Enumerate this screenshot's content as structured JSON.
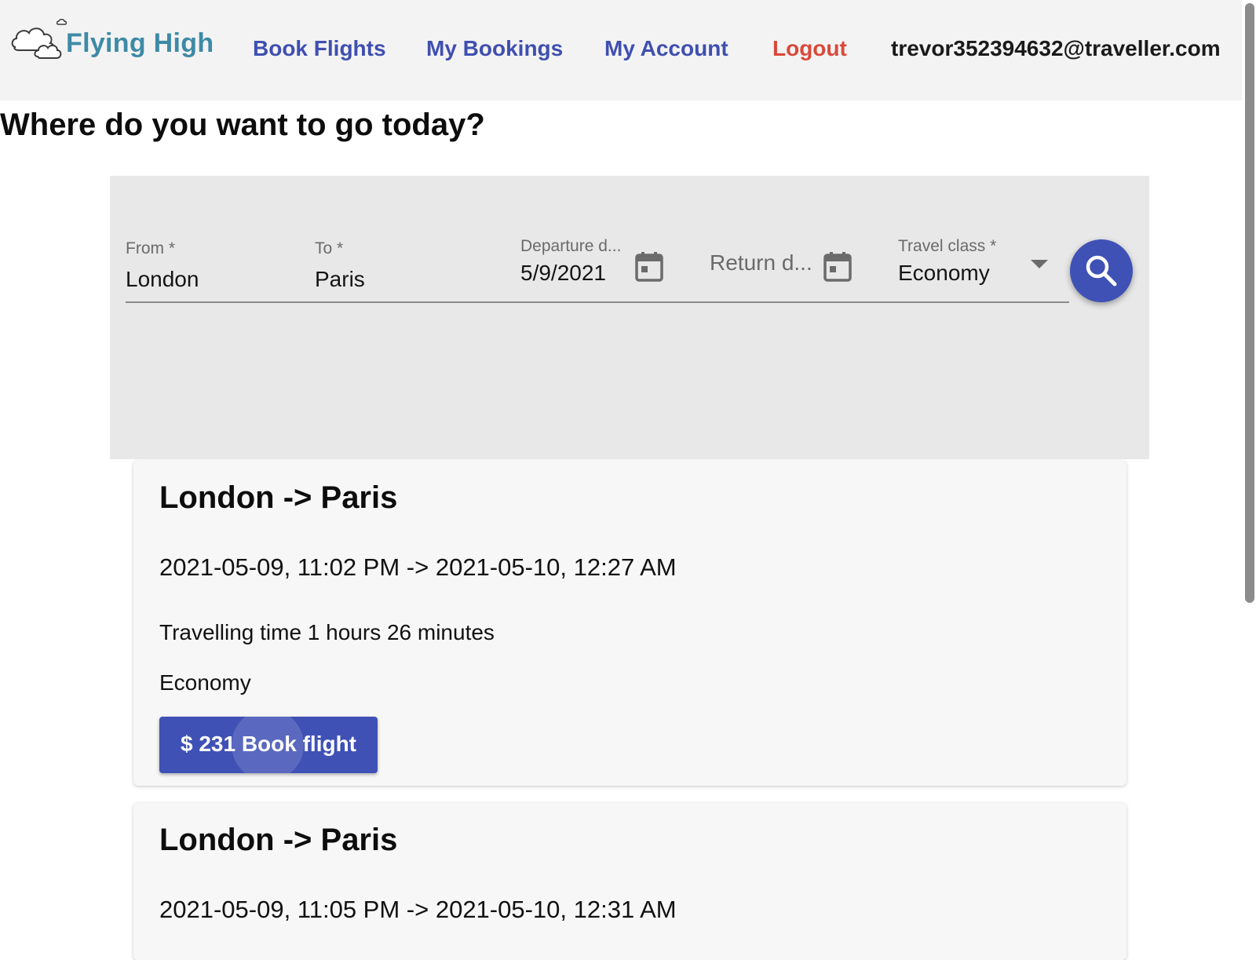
{
  "header": {
    "logo_text": "Flying High",
    "nav": {
      "book_flights": "Book Flights",
      "my_bookings": "My Bookings",
      "my_account": "My Account",
      "logout": "Logout"
    },
    "user_email": "trevor352394632@traveller.com",
    "colors": {
      "brand": "#3e8aa6",
      "link": "#3f4fb0",
      "logout": "#d9493a"
    }
  },
  "page": {
    "title": "Where do you want to go today?"
  },
  "search": {
    "from": {
      "label": "From *",
      "value": "London"
    },
    "to": {
      "label": "To *",
      "value": "Paris"
    },
    "departure": {
      "label": "Departure d...",
      "value": "5/9/2021",
      "icon": "calendar-icon"
    },
    "return": {
      "placeholder": "Return d...",
      "icon": "calendar-icon"
    },
    "travel_class": {
      "label": "Travel class *",
      "value": "Economy",
      "icon": "dropdown-arrow-icon"
    },
    "search_icon": "search-icon",
    "accent_color": "#3f51b5"
  },
  "results": [
    {
      "route": "London -> Paris",
      "times": "2021-05-09, 11:02 PM -> 2021-05-10, 12:27 AM",
      "duration": "Travelling time 1 hours 26 minutes",
      "travel_class": "Economy",
      "book_label": "$ 231 Book flight"
    },
    {
      "route": "London -> Paris",
      "times": "2021-05-09, 11:05 PM -> 2021-05-10, 12:31 AM"
    }
  ]
}
